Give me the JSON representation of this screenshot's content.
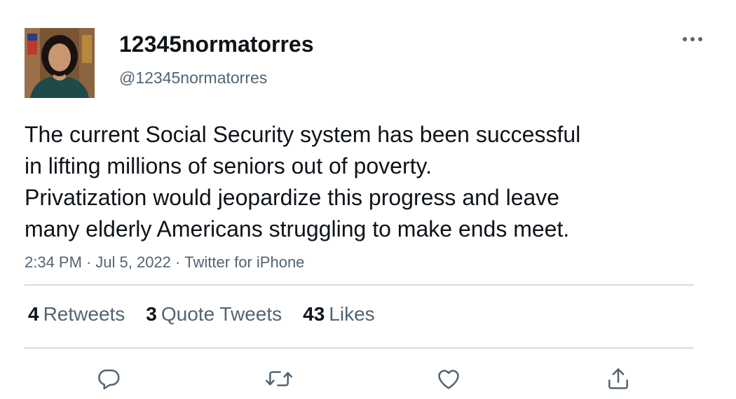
{
  "tweet": {
    "display_name": "12345normatorres",
    "handle": "@12345normatorres",
    "text_lines": [
      "The current Social Security system has been successful",
      "in lifting millions of seniors out of poverty.",
      "Privatization would jeopardize this progress and leave",
      "many elderly Americans struggling to make ends meet."
    ],
    "time": "2:34 PM",
    "separator": "·",
    "date": "Jul 5, 2022",
    "source": "Twitter for iPhone"
  },
  "stats": {
    "retweets": {
      "count": "4",
      "label": "Retweets"
    },
    "quotes": {
      "count": "3",
      "label": "Quote Tweets"
    },
    "likes": {
      "count": "43",
      "label": "Likes"
    }
  },
  "icons": {
    "more": "more-horizontal-icon",
    "reply": "reply-icon",
    "retweet": "retweet-icon",
    "like": "heart-icon",
    "share": "share-icon"
  },
  "colors": {
    "text": "#0f1419",
    "secondary": "#536471",
    "divider": "#d9dde0"
  }
}
